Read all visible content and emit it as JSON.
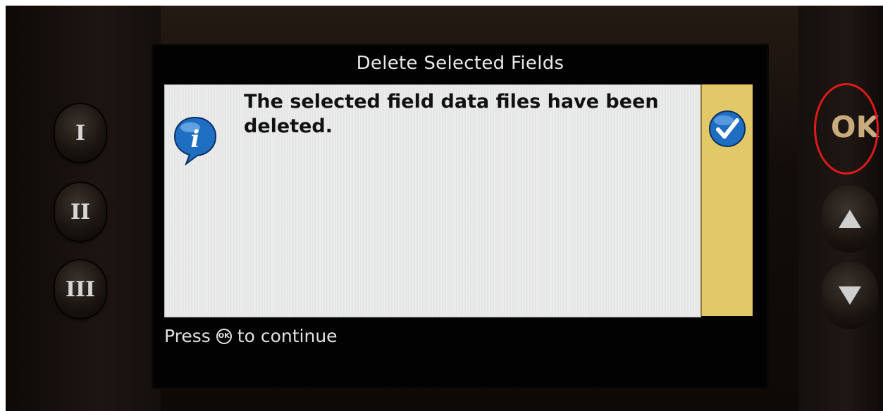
{
  "screen": {
    "title": "Delete Selected Fields",
    "message": "The selected field data files have been deleted.",
    "footer_prefix": "Press",
    "footer_ok_glyph": "OK",
    "footer_suffix": "to continue",
    "info_icon": "info-icon",
    "confirm_icon": "checkmark-icon",
    "colors": {
      "dialog_bg": "#ececec",
      "side_panel": "#e3c867",
      "icon_blue": "#1e6fc2",
      "highlight_circle": "#e01a1a"
    }
  },
  "hardware": {
    "left_buttons": [
      "I",
      "II",
      "III"
    ],
    "ok_label": "OK",
    "up_icon": "arrow-up-icon",
    "down_icon": "arrow-down-icon"
  }
}
